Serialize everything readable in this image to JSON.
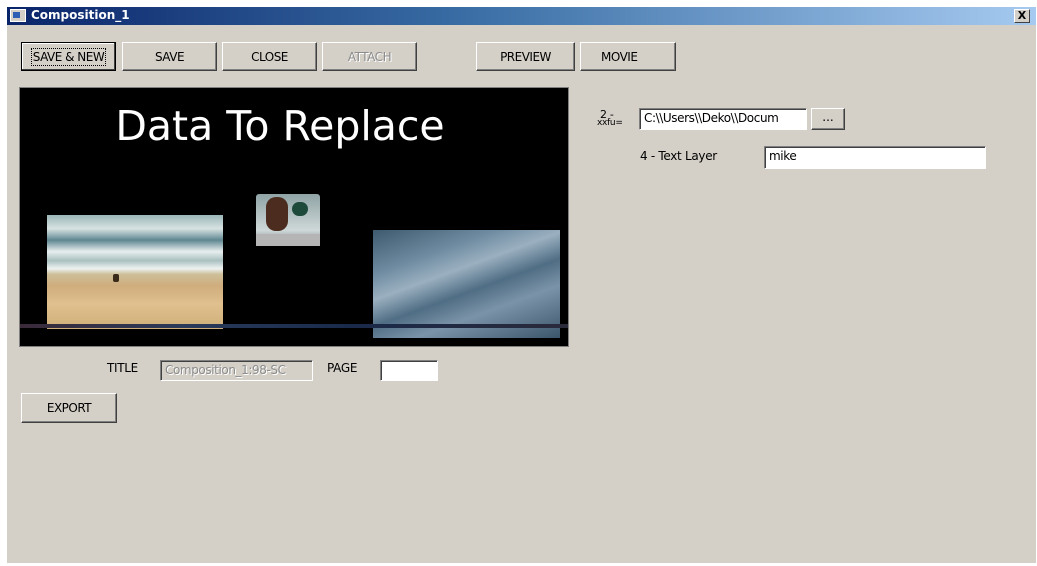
{
  "window": {
    "title": "Composition_1",
    "close_label": "X"
  },
  "toolbar": {
    "save_new": "SAVE & NEW",
    "save": "SAVE",
    "close": "CLOSE",
    "attach": "ATTACH",
    "preview": "PREVIEW",
    "movie": "MOVIE"
  },
  "preview": {
    "heading": "Data To Replace"
  },
  "form": {
    "title_label": "TITLE",
    "title_value": "Composition_1:98-SC",
    "page_label": "PAGE",
    "page_value": "",
    "export": "EXPORT"
  },
  "layers": {
    "layer2_label_line1": "2 -",
    "layer2_label_line2": "xxfu=",
    "layer2_path": "C:\\\\Users\\\\Deko\\\\Docum",
    "browse_label": "...",
    "layer4_label": "4 - Text Layer",
    "layer4_value": "mike"
  }
}
